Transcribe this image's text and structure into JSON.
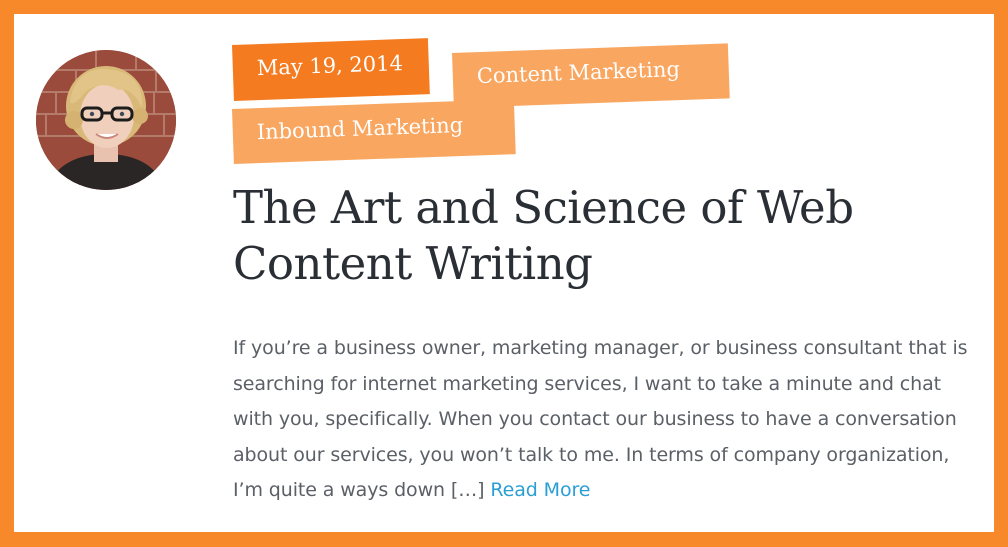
{
  "post": {
    "author_avatar_alt": "",
    "tags": {
      "date": "May 19, 2014",
      "category_1": "Content Marketing",
      "category_2": "Inbound Marketing"
    },
    "title": "The Art and Science of Web Content Writing",
    "excerpt": "If you’re a business owner, marketing manager, or business consultant that is searching for internet marketing services, I want to take a minute and chat with you, specifically. When you contact our business to have a conversation about our services, you won’t talk to me. In terms of company organization, I’m quite a ways down […] ",
    "read_more_label": "Read More"
  },
  "colors": {
    "frame": "#f7892a",
    "tag_primary": "#f47b20",
    "tag_secondary": "#f9a660",
    "title_text": "#2a2e35",
    "body_text": "#5b5f66",
    "link": "#2a9fd6"
  },
  "icons": {
    "avatar": "author-photo"
  }
}
